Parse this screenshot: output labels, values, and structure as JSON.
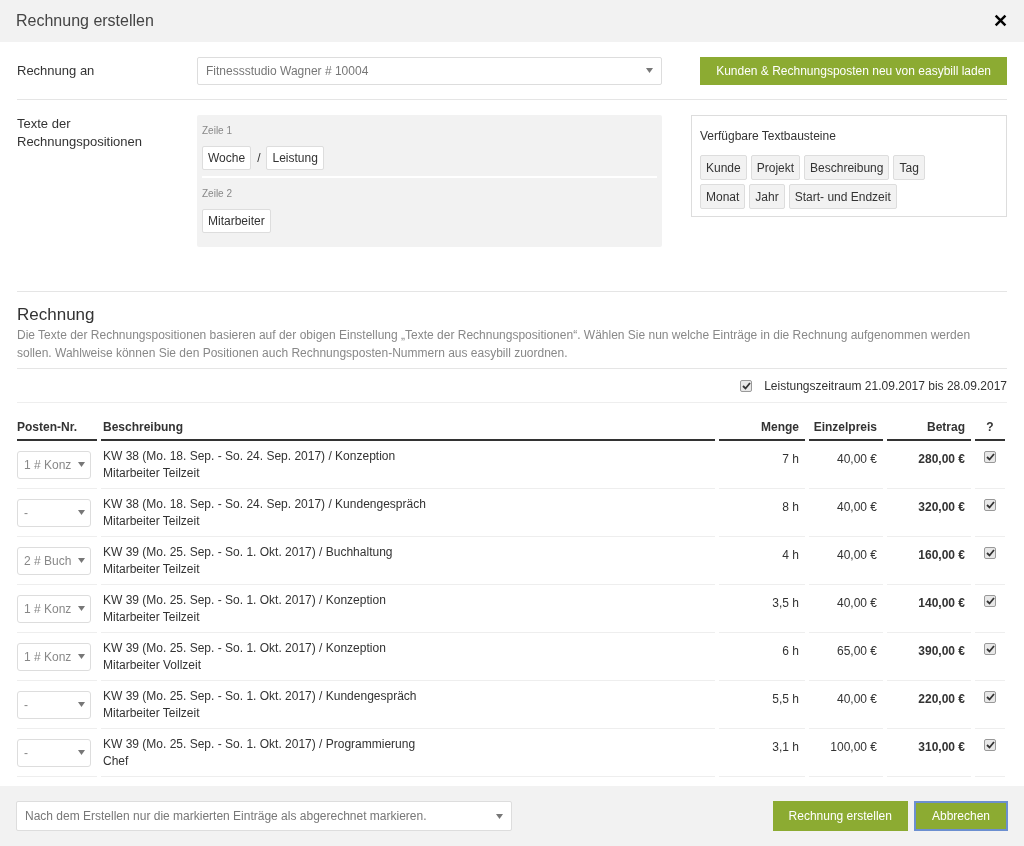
{
  "window": {
    "title": "Rechnung erstellen",
    "close": "✕"
  },
  "recipient": {
    "label": "Rechnung an",
    "value": "Fitnessstudio Wagner # 10004",
    "button": "Kunden & Rechnungsposten neu von easybill laden"
  },
  "texts": {
    "label": "Texte der Rechnungspositionen",
    "lines": [
      {
        "label": "Zeile 1",
        "tokens": [
          "Woche",
          "Leistung"
        ],
        "separators": [
          "/"
        ]
      },
      {
        "label": "Zeile 2",
        "tokens": [
          "Mitarbeiter"
        ]
      }
    ],
    "available_title": "Verfügbare Textbausteine",
    "available": [
      [
        "Kunde",
        "Projekt",
        "Beschreibung",
        "Tag"
      ],
      [
        "Monat",
        "Jahr",
        "Start- und Endzeit"
      ]
    ]
  },
  "invoice": {
    "title": "Rechnung",
    "description": "Die Texte der Rechnungspositionen basieren auf der obigen Einstellung „Texte der Rechnungspositionen“. Wählen Sie nun welche Einträge in die Rechnung aufgenommen werden sollen. Wahlweise können Sie den Positionen auch Rechnungsposten-Nummern aus easybill zuordnen.",
    "period": {
      "label": "Leistungszeitraum 21.09.2017 bis 28.09.2017",
      "checked": true
    }
  },
  "table": {
    "columns": [
      "Posten-Nr.",
      "Beschreibung",
      "Menge",
      "Einzelpreis",
      "Betrag",
      "?"
    ],
    "rows": [
      {
        "item": "1 # Konz",
        "line1": "KW 38 (Mo. 18. Sep. - So. 24. Sep. 2017) / Konzeption",
        "line2": "Mitarbeiter Teilzeit",
        "qty": "7 h",
        "price": "40,00 €",
        "amount": "280,00 €",
        "checked": true
      },
      {
        "item": "-",
        "line1": "KW 38 (Mo. 18. Sep. - So. 24. Sep. 2017) / Kundengespräch",
        "line2": "Mitarbeiter Teilzeit",
        "qty": "8 h",
        "price": "40,00 €",
        "amount": "320,00 €",
        "checked": true
      },
      {
        "item": "2 # Buch",
        "line1": "KW 39 (Mo. 25. Sep. - So. 1. Okt. 2017) / Buchhaltung",
        "line2": "Mitarbeiter Teilzeit",
        "qty": "4 h",
        "price": "40,00 €",
        "amount": "160,00 €",
        "checked": true
      },
      {
        "item": "1 # Konz",
        "line1": "KW 39 (Mo. 25. Sep. - So. 1. Okt. 2017) / Konzeption",
        "line2": "Mitarbeiter Teilzeit",
        "qty": "3,5 h",
        "price": "40,00 €",
        "amount": "140,00 €",
        "checked": true
      },
      {
        "item": "1 # Konz",
        "line1": "KW 39 (Mo. 25. Sep. - So. 1. Okt. 2017) / Konzeption",
        "line2": "Mitarbeiter Vollzeit",
        "qty": "6 h",
        "price": "65,00 €",
        "amount": "390,00 €",
        "checked": true
      },
      {
        "item": "-",
        "line1": "KW 39 (Mo. 25. Sep. - So. 1. Okt. 2017) / Kundengespräch",
        "line2": "Mitarbeiter Teilzeit",
        "qty": "5,5 h",
        "price": "40,00 €",
        "amount": "220,00 €",
        "checked": true
      },
      {
        "item": "-",
        "line1": "KW 39 (Mo. 25. Sep. - So. 1. Okt. 2017) / Programmierung",
        "line2": "Chef",
        "qty": "3,1 h",
        "price": "100,00 €",
        "amount": "310,00 €",
        "checked": true
      }
    ]
  },
  "footer": {
    "mark_option": "Nach dem Erstellen nur die markierten Einträge als abgerechnet markieren.",
    "buttons": [
      "Rechnung erstellen",
      "Abbrechen"
    ]
  }
}
